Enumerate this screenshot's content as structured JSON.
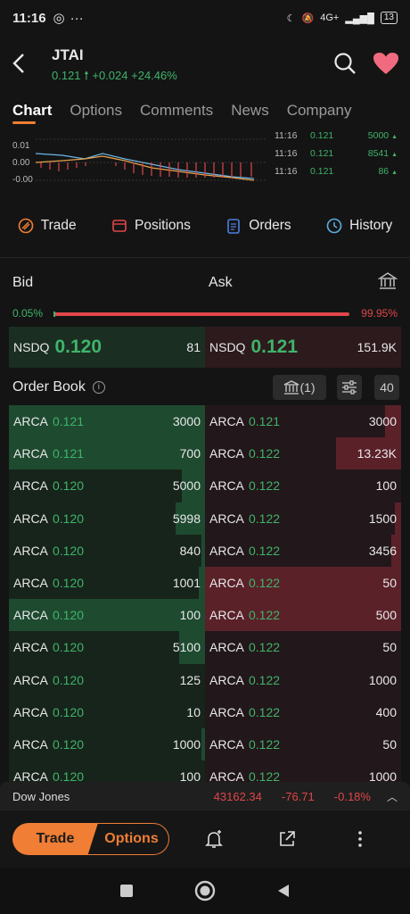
{
  "status": {
    "time": "11:16",
    "network": "4G+",
    "battery": "13"
  },
  "header": {
    "symbol": "JTAI",
    "price": "0.121",
    "change": "+0.024",
    "change_pct": "+24.46%"
  },
  "tabs": [
    "Chart",
    "Options",
    "Comments",
    "News",
    "Company"
  ],
  "chart": {
    "ytick1": "0.01",
    "ytick2": "0.00",
    "ytick3": "-0.00"
  },
  "ticks": [
    {
      "time": "11:16",
      "price": "0.121",
      "vol": "5000"
    },
    {
      "time": "11:16",
      "price": "0.121",
      "vol": "8541"
    },
    {
      "time": "11:16",
      "price": "0.121",
      "vol": "86"
    }
  ],
  "actions": {
    "trade": "Trade",
    "positions": "Positions",
    "orders": "Orders",
    "history": "History"
  },
  "bidask": {
    "bid_label": "Bid",
    "ask_label": "Ask",
    "bid_pct": "0.05%",
    "ask_pct": "99.95%"
  },
  "nbbo": {
    "bid": {
      "exchange": "NSDQ",
      "price": "0.120",
      "size": "81"
    },
    "ask": {
      "exchange": "NSDQ",
      "price": "0.121",
      "size": "151.9K"
    }
  },
  "orderbook": {
    "title": "Order Book",
    "exchange_count": "(1)",
    "depth": "40"
  },
  "book": [
    {
      "bid": {
        "ex": "ARCA",
        "px": "0.121",
        "sz": "3000",
        "fill": 1.0
      },
      "ask": {
        "ex": "ARCA",
        "px": "0.121",
        "sz": "3000",
        "fill": 0.08
      }
    },
    {
      "bid": {
        "ex": "ARCA",
        "px": "0.121",
        "sz": "700",
        "fill": 1.0
      },
      "ask": {
        "ex": "ARCA",
        "px": "0.122",
        "sz": "13.23K",
        "fill": 0.33
      }
    },
    {
      "bid": {
        "ex": "ARCA",
        "px": "0.120",
        "sz": "5000",
        "fill": 0.12
      },
      "ask": {
        "ex": "ARCA",
        "px": "0.122",
        "sz": "100",
        "fill": 0.0
      }
    },
    {
      "bid": {
        "ex": "ARCA",
        "px": "0.120",
        "sz": "5998",
        "fill": 0.15
      },
      "ask": {
        "ex": "ARCA",
        "px": "0.122",
        "sz": "1500",
        "fill": 0.03
      }
    },
    {
      "bid": {
        "ex": "ARCA",
        "px": "0.120",
        "sz": "840",
        "fill": 0.02
      },
      "ask": {
        "ex": "ARCA",
        "px": "0.122",
        "sz": "3456",
        "fill": 0.05
      }
    },
    {
      "bid": {
        "ex": "ARCA",
        "px": "0.120",
        "sz": "1001",
        "fill": 0.03
      },
      "ask": {
        "ex": "ARCA",
        "px": "0.122",
        "sz": "50",
        "fill": 1.0
      }
    },
    {
      "bid": {
        "ex": "ARCA",
        "px": "0.120",
        "sz": "100",
        "fill": 1.0
      },
      "ask": {
        "ex": "ARCA",
        "px": "0.122",
        "sz": "500",
        "fill": 1.0
      }
    },
    {
      "bid": {
        "ex": "ARCA",
        "px": "0.120",
        "sz": "5100",
        "fill": 0.13
      },
      "ask": {
        "ex": "ARCA",
        "px": "0.122",
        "sz": "50",
        "fill": 0.0
      }
    },
    {
      "bid": {
        "ex": "ARCA",
        "px": "0.120",
        "sz": "125",
        "fill": 0.0
      },
      "ask": {
        "ex": "ARCA",
        "px": "0.122",
        "sz": "1000",
        "fill": 0.0
      }
    },
    {
      "bid": {
        "ex": "ARCA",
        "px": "0.120",
        "sz": "10",
        "fill": 0.0
      },
      "ask": {
        "ex": "ARCA",
        "px": "0.122",
        "sz": "400",
        "fill": 0.0
      }
    },
    {
      "bid": {
        "ex": "ARCA",
        "px": "0.120",
        "sz": "1000",
        "fill": 0.02
      },
      "ask": {
        "ex": "ARCA",
        "px": "0.122",
        "sz": "50",
        "fill": 0.0
      }
    },
    {
      "bid": {
        "ex": "ARCA",
        "px": "0.120",
        "sz": "100",
        "fill": 0.0
      },
      "ask": {
        "ex": "ARCA",
        "px": "0.122",
        "sz": "1000",
        "fill": 0.0
      }
    }
  ],
  "index": {
    "name": "Dow Jones",
    "value": "43162.34",
    "change": "-76.71",
    "change_pct": "-0.18%"
  },
  "bottom": {
    "trade": "Trade",
    "options": "Options"
  },
  "colors": {
    "accent": "#f07e34",
    "up": "#3fb46a",
    "down": "#e0464a"
  }
}
